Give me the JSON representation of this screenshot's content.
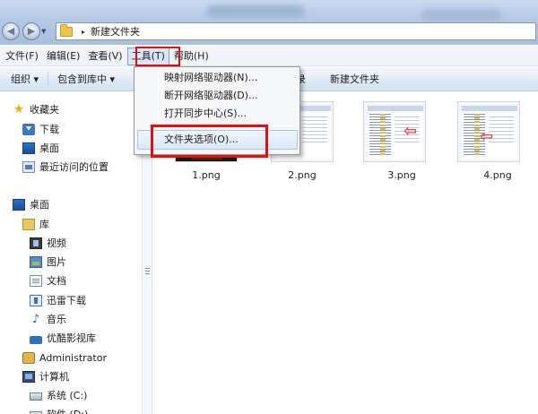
{
  "address_bar": {
    "breadcrumb_separator": "▸",
    "current_folder": "新建文件夹"
  },
  "menu_bar": {
    "items": [
      "文件(F)",
      "编辑(E)",
      "查看(V)",
      "工具(T)",
      "帮助(H)"
    ]
  },
  "command_bar": {
    "organize": "组织 ▾",
    "include_in_library": "包含到库中 ▾",
    "hidden_item_fragment": "录",
    "new_folder": "新建文件夹"
  },
  "tools_menu": {
    "items": [
      "映射网络驱动器(N)...",
      "断开网络驱动器(D)...",
      "打开同步中心(S)...",
      "文件夹选项(O)..."
    ],
    "highlighted_index": 3
  },
  "nav_tree": {
    "favorites": "收藏夹",
    "downloads": "下载",
    "desktop_fav": "桌面",
    "recent": "最近访问的位置",
    "desktop": "桌面",
    "libraries": "库",
    "videos": "视频",
    "pictures": "图片",
    "documents": "文档",
    "xunlei": "迅雷下载",
    "music": "音乐",
    "youku": "优酷影视库",
    "user": "Administrator",
    "computer": "计算机",
    "drive_c": "系统 (C:)",
    "drive_d": "软件 (D:)"
  },
  "files": [
    "1.png",
    "2.png",
    "3.png",
    "4.png"
  ],
  "colors": {
    "annotation_red": "#e01010",
    "menu_highlight": "#d7e6f8",
    "chrome_blue": "#b3c9e4"
  },
  "icons": {
    "back": "back-arrow-icon",
    "forward": "forward-arrow-icon",
    "folder": "folder-icon",
    "favorites": "star-icon"
  }
}
